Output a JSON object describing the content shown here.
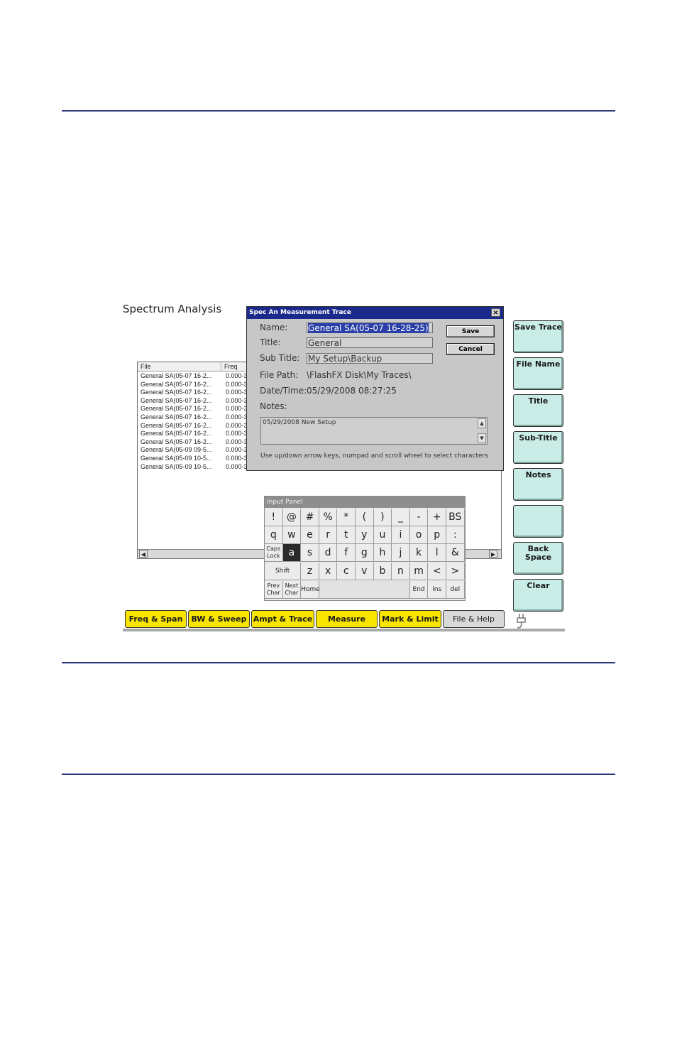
{
  "screen_title": "Spectrum Analysis",
  "file_list": {
    "columns": [
      "File",
      "Freq"
    ],
    "rows": [
      [
        "General SA(05-07 16-2...",
        "0.000-3"
      ],
      [
        "General SA(05-07 16-2...",
        "0.000-3"
      ],
      [
        "General SA(05-07 16-2...",
        "0.000-3"
      ],
      [
        "General SA(05-07 16-2...",
        "0.000-3"
      ],
      [
        "General SA(05-07 16-2...",
        "0.000-3"
      ],
      [
        "General SA(05-07 16-2...",
        "0.000-3"
      ],
      [
        "General SA(05-07 16-2...",
        "0.000-3"
      ],
      [
        "General SA(05-07 16-2...",
        "0.000-3"
      ],
      [
        "General SA(05-07 16-2...",
        "0.000-3"
      ],
      [
        "General SA(05-09 09-5...",
        "0.000-3"
      ],
      [
        "General SA(05-09 10-5...",
        "0.000-3"
      ],
      [
        "General SA(05-09 10-5...",
        "0.000-3"
      ]
    ]
  },
  "dialog": {
    "title": "Spec An Measurement Trace",
    "close": "×",
    "name_label": "Name:",
    "name_value": "General SA(05-07 16-28-25)",
    "title_label": "Title:",
    "title_value": "General",
    "subtitle_label": "Sub Title:",
    "subtitle_value": "My Setup\\Backup",
    "filepath_label": "File Path:",
    "filepath_value": "\\FlashFX Disk\\My Traces\\",
    "datetime_label": "Date/Time:",
    "datetime_value": "05/29/2008 08:27:25",
    "notes_label": "Notes:",
    "notes_value": "05/29/2008 New Setup",
    "hint": "Use up/down arrow keys, numpad and scroll wheel to select characters",
    "save": "Save",
    "cancel": "Cancel"
  },
  "input_panel": {
    "title": "Input Panel",
    "row1": [
      "!",
      "@",
      "#",
      "%",
      "*",
      "(",
      ")",
      "_",
      "-",
      "+",
      "BS"
    ],
    "row2": [
      "q",
      "w",
      "e",
      "r",
      "t",
      "y",
      "u",
      "i",
      "o",
      "p",
      ":"
    ],
    "row3": [
      "Caps Lock",
      "a",
      "s",
      "d",
      "f",
      "g",
      "h",
      "j",
      "k",
      "l",
      "&"
    ],
    "row4": [
      "Shift",
      "z",
      "x",
      "c",
      "v",
      "b",
      "n",
      "m",
      "<",
      ">"
    ],
    "row5": [
      "Prev Char",
      "Next Char",
      "Home",
      "",
      "End",
      "ins",
      "del"
    ]
  },
  "softkeys": [
    "Save Trace",
    "File Name",
    "Title",
    "Sub-Title",
    "Notes",
    "",
    "Back Space",
    "Clear"
  ],
  "tabs": [
    "Freq & Span",
    "BW & Sweep",
    "Ampt &  Trace",
    "Measure",
    "Mark & Limit",
    "File & Help"
  ],
  "colors": {
    "rule": "#2b3a7a",
    "dialog_titlebar": "#1a2a8c",
    "softkey": "#c9ece6",
    "tab": "#f7e400",
    "tab_active": "#d9d9d9"
  }
}
